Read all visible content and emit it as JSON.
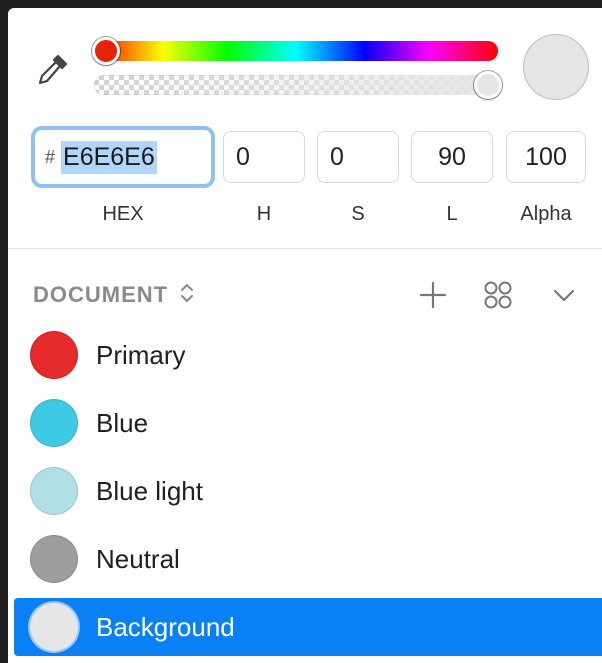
{
  "picker": {
    "current_color": "#E6E6E6",
    "hue_thumb_color": "#E8220A",
    "alpha_level": 1.0
  },
  "inputs": {
    "hex_prefix": "#",
    "hex_value": "E6E6E6",
    "h": "0",
    "s": "0",
    "l": "90",
    "alpha": "100"
  },
  "labels": {
    "hex": "HEX",
    "h": "H",
    "s": "S",
    "l": "L",
    "alpha": "Alpha"
  },
  "icons": {
    "eyedropper": "eyedropper-icon",
    "sort": "up-down-chevron-icon",
    "add": "plus-icon",
    "grid": "grid-view-icon",
    "collapse": "chevron-down-icon"
  },
  "document": {
    "title": "DOCUMENT",
    "colors": [
      {
        "name": "Primary",
        "hex": "#E52A2A",
        "selected": false
      },
      {
        "name": "Blue",
        "hex": "#3DCBE3",
        "selected": false
      },
      {
        "name": "Blue light",
        "hex": "#B0DFE6",
        "selected": false
      },
      {
        "name": "Neutral",
        "hex": "#9E9E9E",
        "selected": false
      },
      {
        "name": "Background",
        "hex": "#E6E6E6",
        "selected": true
      }
    ]
  },
  "colors": {
    "accent": "#0A80F5",
    "focus_ring": "#8FBFF5",
    "selection": "#B3D5FB"
  }
}
